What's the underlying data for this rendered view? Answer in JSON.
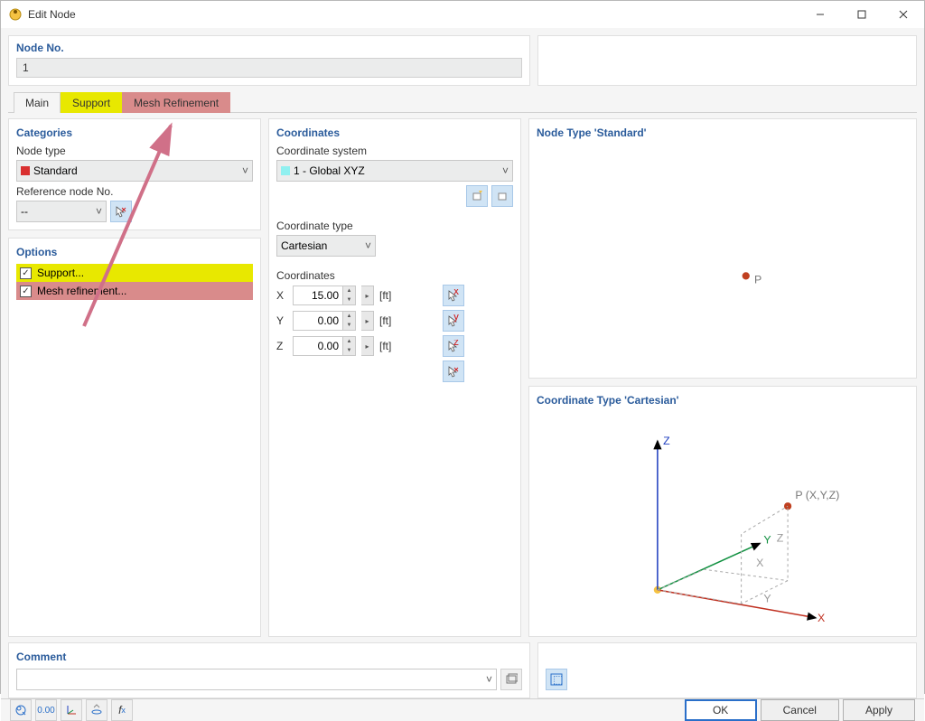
{
  "window": {
    "title": "Edit Node"
  },
  "node_no": {
    "label": "Node No.",
    "value": "1"
  },
  "tabs": {
    "main": "Main",
    "support": "Support",
    "mesh": "Mesh Refinement"
  },
  "categories": {
    "title": "Categories",
    "node_type_label": "Node type",
    "node_type_value": "Standard",
    "ref_node_label": "Reference node No.",
    "ref_node_value": "--"
  },
  "options": {
    "title": "Options",
    "support": "Support...",
    "mesh": "Mesh refinement..."
  },
  "coords": {
    "title": "Coordinates",
    "system_label": "Coordinate system",
    "system_value": "1 - Global XYZ",
    "type_label": "Coordinate type",
    "type_value": "Cartesian",
    "xyz_title": "Coordinates",
    "rows": [
      {
        "axis": "X",
        "value": "15.00",
        "unit": "[ft]"
      },
      {
        "axis": "Y",
        "value": "0.00",
        "unit": "[ft]"
      },
      {
        "axis": "Z",
        "value": "0.00",
        "unit": "[ft]"
      }
    ]
  },
  "right": {
    "nodetype_title": "Node Type 'Standard'",
    "coordtype_title": "Coordinate Type 'Cartesian'",
    "p_label": "P",
    "pxyz_label": "P (X,Y,Z)",
    "x": "X",
    "y": "Y",
    "z": "Z"
  },
  "comment": {
    "title": "Comment"
  },
  "buttons": {
    "ok": "OK",
    "cancel": "Cancel",
    "apply": "Apply"
  }
}
